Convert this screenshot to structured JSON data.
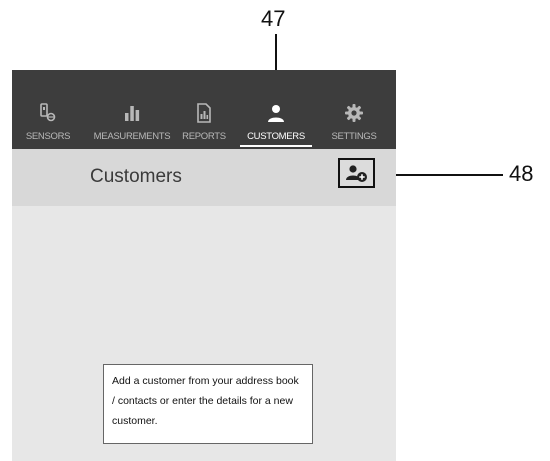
{
  "callouts": {
    "nav_tab_ref": "47",
    "add_button_ref": "48"
  },
  "navbar": {
    "items": [
      {
        "label": "SENSORS",
        "icon": "sensor-icon"
      },
      {
        "label": "MEASUREMENTS",
        "icon": "bar-chart-icon"
      },
      {
        "label": "REPORTS",
        "icon": "report-icon"
      },
      {
        "label": "CUSTOMERS",
        "icon": "customer-icon",
        "active": true
      },
      {
        "label": "SETTINGS",
        "icon": "gear-icon"
      }
    ]
  },
  "header": {
    "title": "Customers",
    "add_button_icon": "add-customer-icon"
  },
  "hint": {
    "text": "Add a customer from your address book / contacts or enter the details for a new customer."
  },
  "colors": {
    "navbar_bg": "#3d3d3d",
    "header_bg": "#d8d8d8",
    "content_bg": "#e7e7e7"
  }
}
